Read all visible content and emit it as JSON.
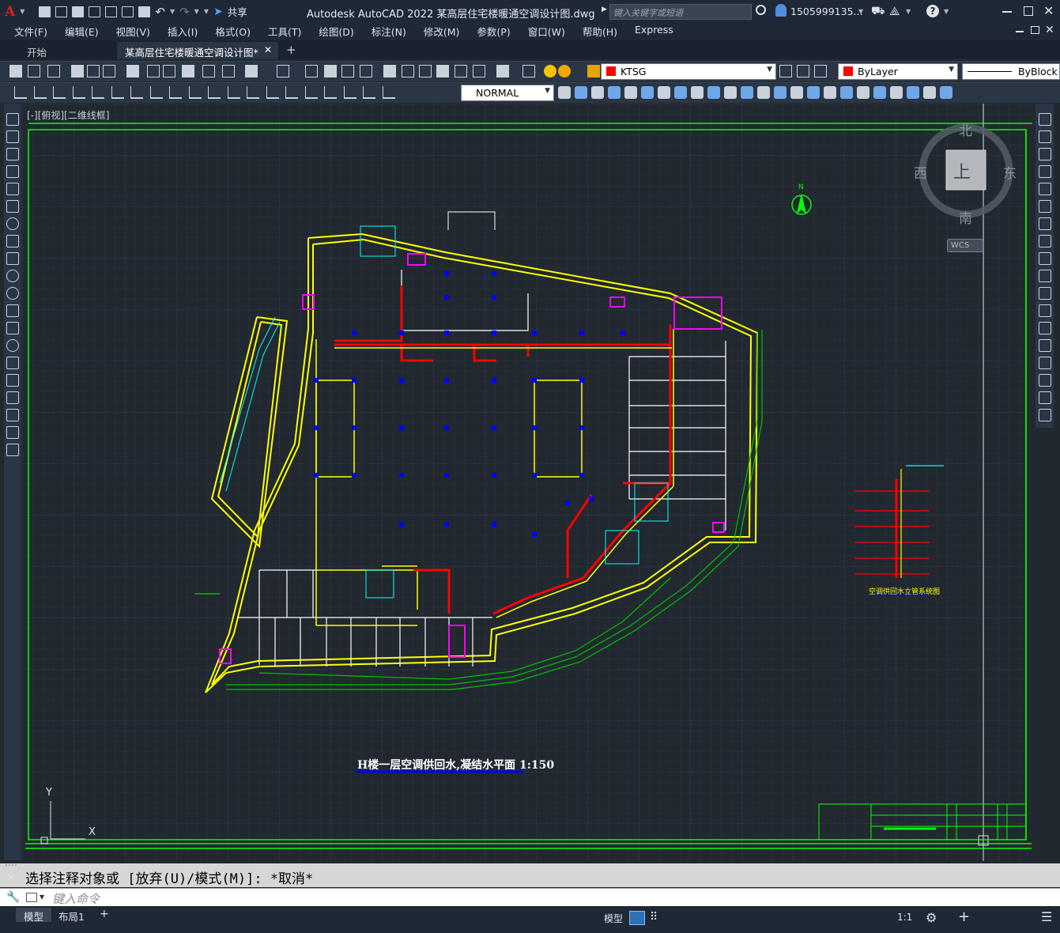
{
  "titlebar": {
    "app_logo": "A",
    "share_label": "共享",
    "title": "Autodesk AutoCAD 2022    某高层住宅楼暖通空调设计图.dwg",
    "search_placeholder": "键入关键字或短语",
    "user": "1505999135...",
    "icons": [
      "new-icon",
      "open-icon",
      "save-icon",
      "saveas-icon",
      "open-web-icon",
      "save-web-icon",
      "plot-icon",
      "undo-icon",
      "redo-icon",
      "share-icon",
      "search-icon",
      "user-icon",
      "cart-icon",
      "autodesk-app-icon",
      "help-icon",
      "minimize-icon",
      "maximize-icon",
      "close-icon"
    ]
  },
  "menu": {
    "items": [
      "文件(F)",
      "编辑(E)",
      "视图(V)",
      "插入(I)",
      "格式(O)",
      "工具(T)",
      "绘图(D)",
      "标注(N)",
      "修改(M)",
      "参数(P)",
      "窗口(W)",
      "帮助(H)",
      "Express"
    ]
  },
  "tabs": {
    "start": "开始",
    "active": "某高层住宅楼暖通空调设计图*",
    "add": "+"
  },
  "toolbar": {
    "layer_value": "KTSG",
    "color_value": "ByLayer",
    "linetype_value": "ByBlock",
    "annostyle_value": "NORMAL"
  },
  "viewport": {
    "label": "[-][俯视][二维线框]",
    "viewcube_face": "上",
    "compass": {
      "north": "北",
      "south": "南",
      "east": "东",
      "west": "西"
    },
    "wcs": "WCS",
    "north_arrow_label": "N",
    "ucs_y": "Y",
    "ucs_x": "X"
  },
  "drawing": {
    "plan_title": "H楼一层空调供回水,凝结水平面 1:150",
    "riser_title": "空调供回水立管系统图"
  },
  "command": {
    "history": "选择注释对象或 [放弃(U)/模式(M)]: *取消*",
    "placeholder": "键入命令"
  },
  "layout": {
    "model_tab": "模型",
    "layout1_tab": "布局1",
    "add": "+"
  },
  "status": {
    "model_label": "模型",
    "scale": "1:1"
  },
  "colors": {
    "border_green": "#00ff00",
    "wall_yellow": "#ffff00",
    "pipe_red": "#ff0000",
    "magenta": "#ff00ff",
    "cyan": "#00ffff",
    "white": "#ffffff",
    "blue": "#0000ff"
  }
}
